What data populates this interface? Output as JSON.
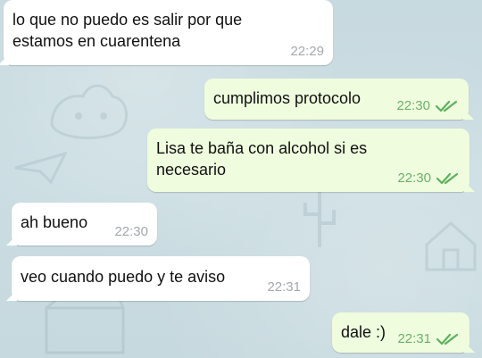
{
  "chat": {
    "messages": [
      {
        "text": "lo que no puedo es salir por que\nestamos en cuarentena",
        "time": "22:29",
        "direction": "incoming"
      },
      {
        "text": "cumplimos protocolo",
        "time": "22:30",
        "direction": "outgoing",
        "read": true
      },
      {
        "text": "Lisa te baña con alcohol si es\nnecesario",
        "time": "22:30",
        "direction": "outgoing",
        "read": true
      },
      {
        "text": "ah bueno",
        "time": "22:30",
        "direction": "incoming"
      },
      {
        "text": "veo cuando puedo y te aviso",
        "time": "22:31",
        "direction": "incoming"
      },
      {
        "text": "dale :)",
        "time": "22:31",
        "direction": "outgoing",
        "read": true
      }
    ]
  },
  "colors": {
    "background": "#c9dbe1",
    "incoming_bubble": "#ffffff",
    "outgoing_bubble": "#effdde",
    "incoming_time": "#a3a8ad",
    "outgoing_time": "#6cb06b",
    "read_check": "#5db15e"
  },
  "icons": {
    "read_receipt": "double-check-icon"
  }
}
